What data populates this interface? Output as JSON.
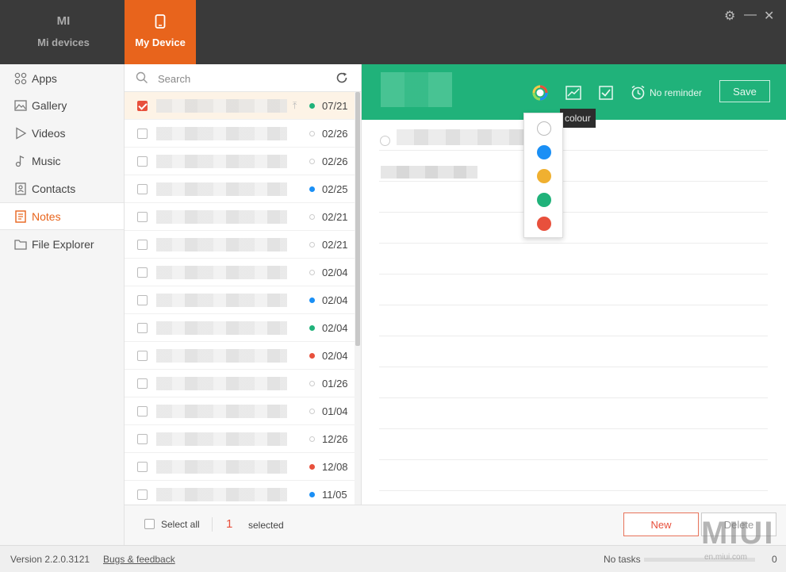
{
  "titlebar": {
    "tabs": [
      {
        "label": "Mi devices",
        "icon": "mi-logo-icon",
        "glyph": "MI"
      },
      {
        "label": "My Device",
        "icon": "phone-icon"
      }
    ],
    "controls": {
      "settings": "⚙",
      "minimize": "—",
      "close": "✕"
    }
  },
  "sidebar": {
    "items": [
      {
        "label": "Apps",
        "icon": "apps-icon"
      },
      {
        "label": "Gallery",
        "icon": "gallery-icon"
      },
      {
        "label": "Videos",
        "icon": "videos-icon"
      },
      {
        "label": "Music",
        "icon": "music-icon"
      },
      {
        "label": "Contacts",
        "icon": "contacts-icon"
      },
      {
        "label": "Notes",
        "icon": "notes-icon",
        "active": true
      },
      {
        "label": "File Explorer",
        "icon": "folder-icon"
      }
    ]
  },
  "search": {
    "placeholder": "Search",
    "value": ""
  },
  "notes": [
    {
      "date": "07/21",
      "color": "#20b27a",
      "selected": true,
      "pinned": true
    },
    {
      "date": "02/26",
      "color": "none"
    },
    {
      "date": "02/26",
      "color": "none"
    },
    {
      "date": "02/25",
      "color": "#1a8ff5"
    },
    {
      "date": "02/21",
      "color": "none"
    },
    {
      "date": "02/21",
      "color": "none"
    },
    {
      "date": "02/04",
      "color": "none"
    },
    {
      "date": "02/04",
      "color": "#1a8ff5"
    },
    {
      "date": "02/04",
      "color": "#20b27a"
    },
    {
      "date": "02/04",
      "color": "#e8503c"
    },
    {
      "date": "01/26",
      "color": "none"
    },
    {
      "date": "01/04",
      "color": "none"
    },
    {
      "date": "12/26",
      "color": "none"
    },
    {
      "date": "12/08",
      "color": "#e8503c"
    },
    {
      "date": "11/05",
      "color": "#1a8ff5"
    }
  ],
  "list_footer": {
    "select_all": "Select all",
    "count": "1",
    "selected_label": "selected"
  },
  "editor": {
    "reminder": "No reminder",
    "save": "Save",
    "tooltip": "colour",
    "color_options": [
      "#ffffff",
      "#1a8ff5",
      "#f0b030",
      "#20b27a",
      "#e8503c"
    ]
  },
  "buttons": {
    "new": "New",
    "delete": "Delete"
  },
  "status": {
    "version": "Version 2.2.0.3121",
    "bugs": "Bugs & feedback",
    "tasks": "No tasks",
    "task_count": "0"
  },
  "watermark": {
    "logo": "MIUI",
    "site": "en.miui.com"
  }
}
